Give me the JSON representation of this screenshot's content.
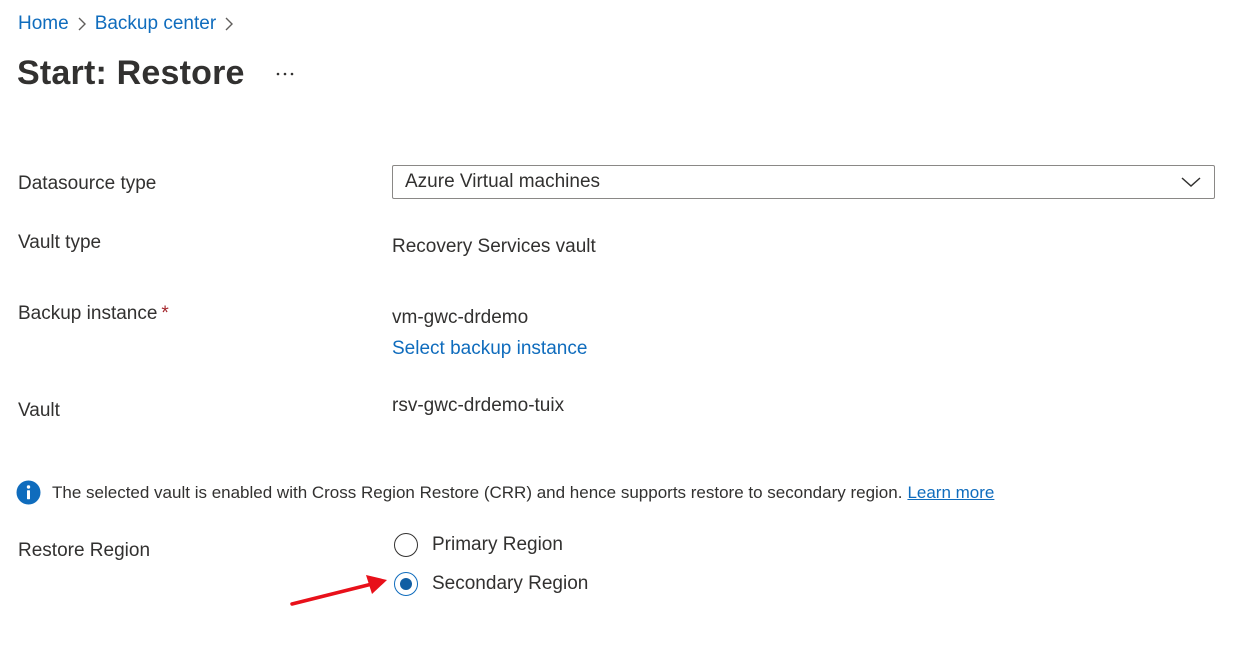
{
  "breadcrumb": {
    "items": [
      "Home",
      "Backup center"
    ]
  },
  "header": {
    "title": "Start: Restore",
    "more_icon": "more-ellipsis-icon"
  },
  "form": {
    "datasource_type": {
      "label": "Datasource type",
      "selected": "Azure Virtual machines"
    },
    "vault_type": {
      "label": "Vault type",
      "value": "Recovery Services vault"
    },
    "backup_instance": {
      "label": "Backup instance",
      "required_mark": "*",
      "value": "vm-gwc-drdemo",
      "link": "Select backup instance"
    },
    "vault": {
      "label": "Vault",
      "value": "rsv-gwc-drdemo-tuix"
    },
    "info": {
      "icon": "info-icon",
      "text": "The selected vault is enabled with Cross Region Restore (CRR) and hence supports restore to secondary region.",
      "link": "Learn more"
    },
    "restore_region": {
      "label": "Restore Region",
      "options": [
        "Primary Region",
        "Secondary Region"
      ],
      "selected": "Secondary Region"
    }
  },
  "colors": {
    "link": "#0f6cbd",
    "radio_selected": "#115ea3",
    "required": "#a4262c",
    "annotation_arrow": "#e8101a",
    "info_icon": "#0f6cbd"
  }
}
